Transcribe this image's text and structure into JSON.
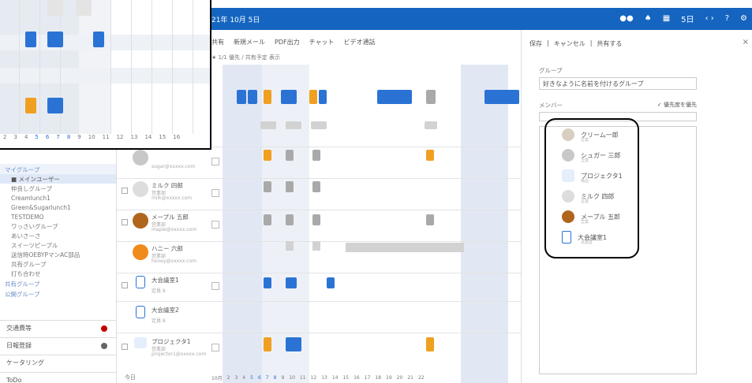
{
  "topbar": {
    "date": "21年 10月 5日",
    "icons": [
      "people-icon",
      "calendar-icon",
      "help-icon",
      "gear-icon"
    ],
    "period": "5日",
    "help": "?"
  },
  "toolbar": {
    "items": [
      "共有",
      "新規メール",
      "PDF出力",
      "チャット",
      "ビデオ通話"
    ]
  },
  "subbar": {
    "text": "★ 1/1 優先 / 共有予定 表示"
  },
  "sidebar": {
    "my_group": "マイグループ",
    "items": [
      "■ メインユーザー",
      "仲良しグループ",
      "Creamlunch1",
      "Green&Sugarlunch1",
      "TESTDEMO",
      "ワっさいグループ",
      "あいさーさ",
      "スイーツピープル",
      "送信時OEBYPマンAC部品",
      "共有グループ",
      "打ち合わせ"
    ],
    "shared_group": "共有グループ",
    "public_group": "公開グループ",
    "menu": [
      {
        "label": "交通費等",
        "dot": "#c00000"
      },
      {
        "label": "日報登録",
        "dot": "#666666"
      },
      {
        "label": "ケータリング",
        "dot": ""
      },
      {
        "label": "ToDo",
        "dot": ""
      }
    ]
  },
  "grid": {
    "members": [
      {
        "name": "",
        "desc": "",
        "mail": "sugar@xxxxx.com"
      },
      {
        "name": "ミルク 四郎",
        "desc": "営業部",
        "mail": "milk@xxxxx.com"
      },
      {
        "name": "メープル 五郎",
        "desc": "営業部",
        "mail": "maple@xxxxx.com"
      },
      {
        "name": "ハニー 六郎",
        "desc": "営業部",
        "mail": "honey@xxxxx.com"
      },
      {
        "name": "大会議室1",
        "desc": "定員 8",
        "mail": ""
      },
      {
        "name": "大会議室2",
        "desc": "定員 8",
        "mail": ""
      },
      {
        "name": "プロジェクタ1",
        "desc": "営業部",
        "mail": "projector1@xxxxx.com"
      }
    ],
    "days_label": "今日",
    "days": [
      "10月",
      "2",
      "3",
      "4",
      "5",
      "6",
      "7",
      "8",
      "9",
      "10",
      "11",
      "12",
      "13",
      "14",
      "15",
      "16",
      "17",
      "18",
      "19",
      "20",
      "21",
      "22"
    ]
  },
  "panel": {
    "save": "保存",
    "cancel": "キャンセル",
    "share": "共有する",
    "close": "×",
    "group_label": "グループ",
    "group_value": "好きなように名前を付けるグループ",
    "member_label": "メンバー",
    "member_hint": "✓ 優先度を優先",
    "members": [
      {
        "name": "クリーム一郎",
        "sub": "営業"
      },
      {
        "name": "シュガー 三郎",
        "sub": "営業"
      },
      {
        "name": "プロジェクタ1",
        "sub": "備品"
      },
      {
        "name": "ミルク 四郎",
        "sub": "営業"
      },
      {
        "name": "メープル 五郎",
        "sub": "営業"
      },
      {
        "name": "大会議室1",
        "sub": "会議室"
      }
    ]
  },
  "inset": {
    "days": [
      "2",
      "3",
      "4",
      "5",
      "6",
      "7",
      "8",
      "9",
      "10",
      "11",
      "12",
      "13",
      "14",
      "15",
      "16"
    ]
  }
}
